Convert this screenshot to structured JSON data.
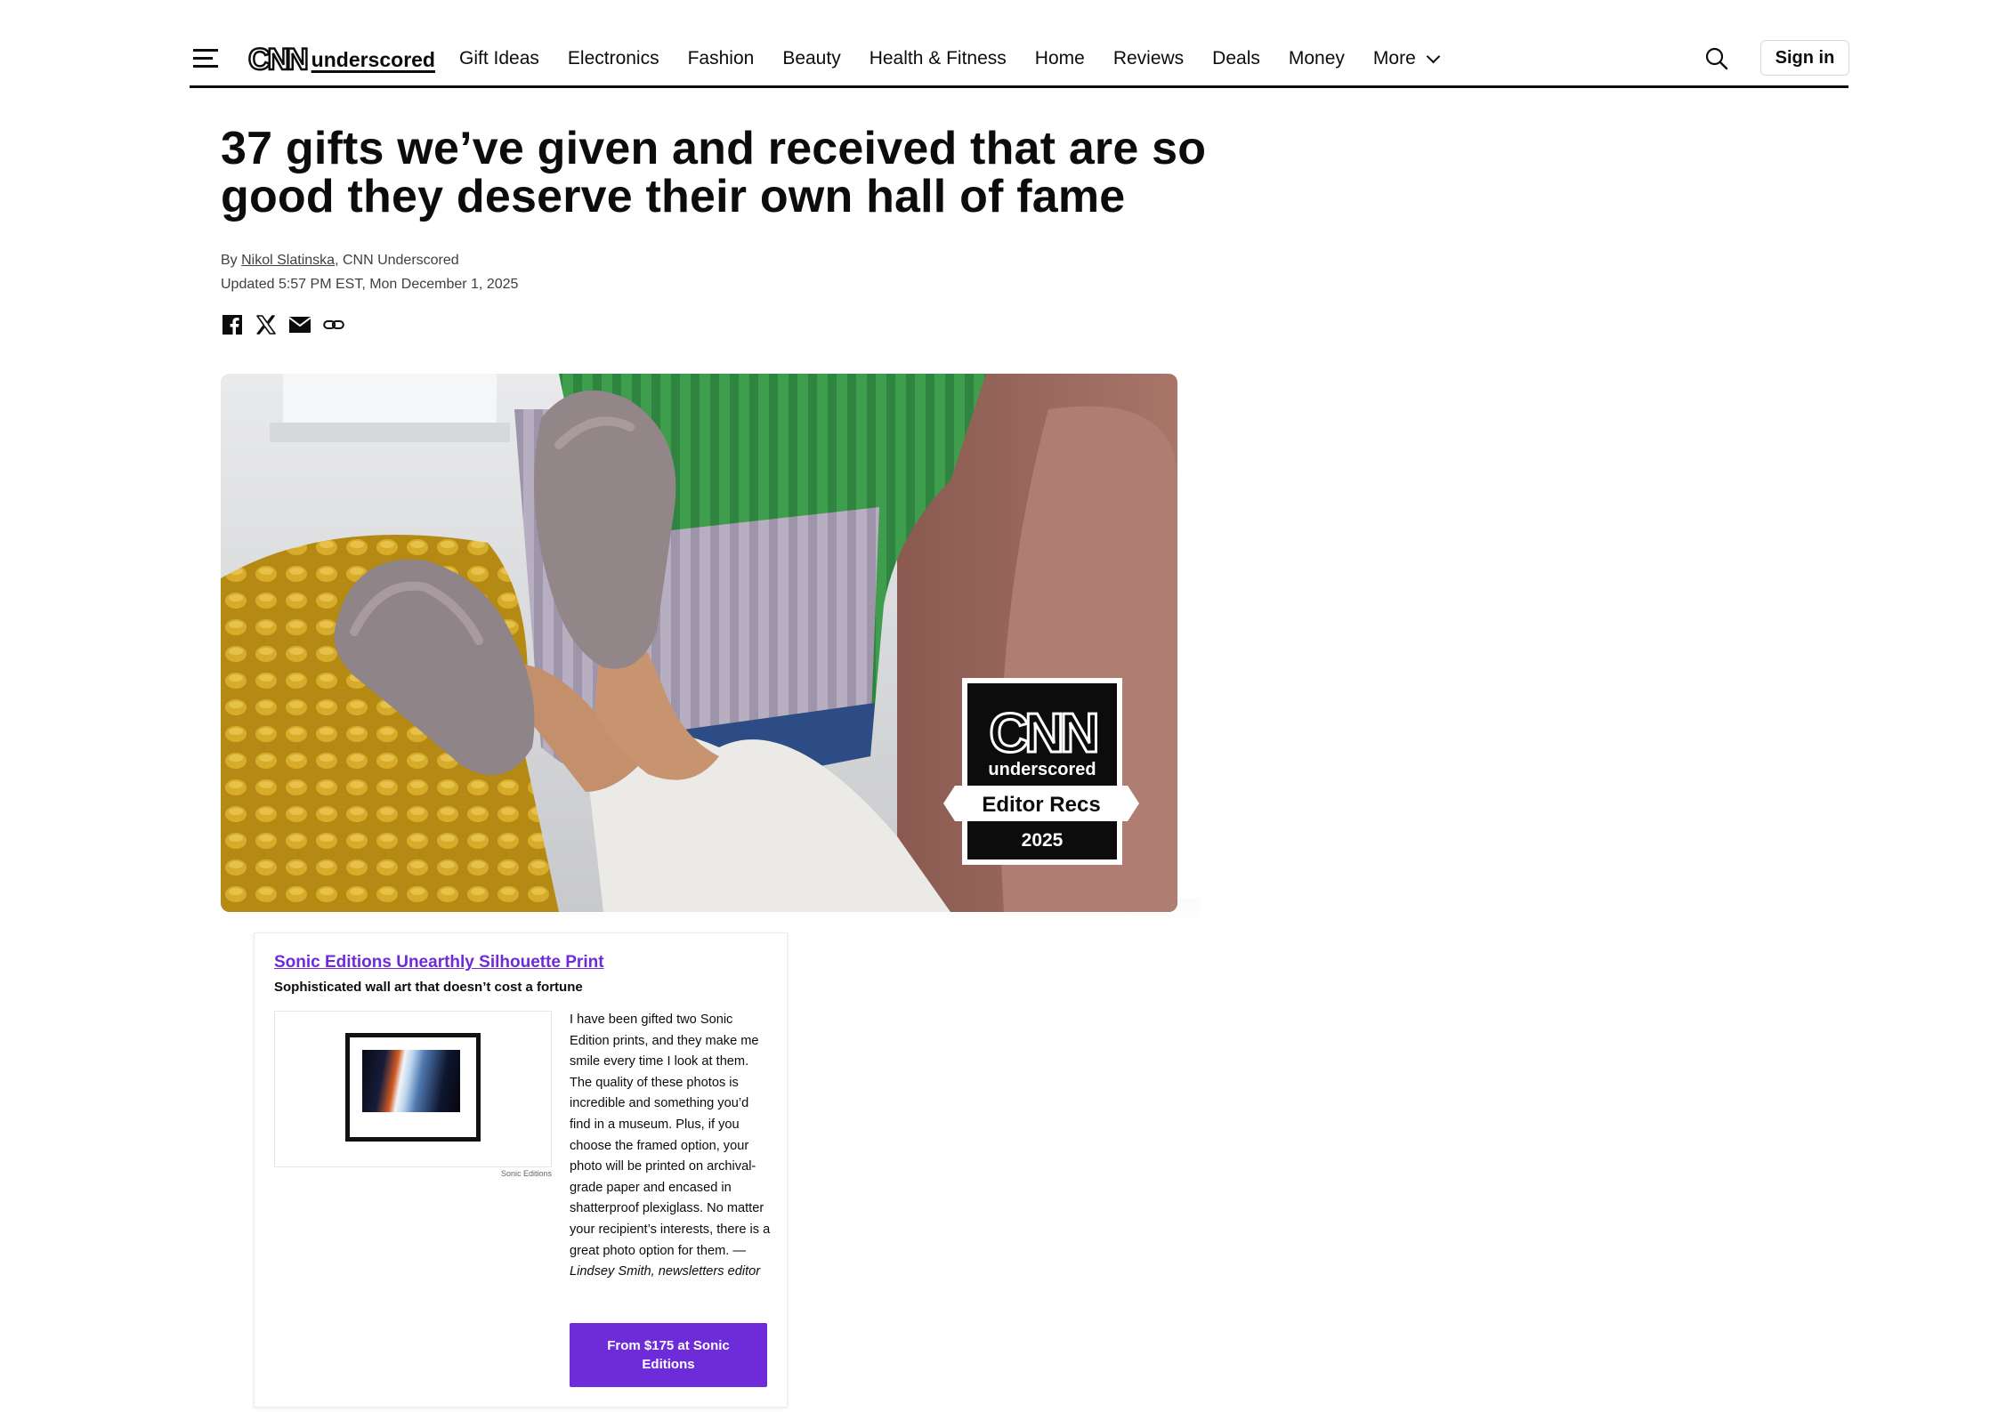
{
  "header": {
    "logo": {
      "mark": "CNN",
      "word": "underscored"
    },
    "nav": [
      "Gift Ideas",
      "Electronics",
      "Fashion",
      "Beauty",
      "Health & Fitness",
      "Home",
      "Reviews",
      "Deals",
      "Money"
    ],
    "more_label": "More",
    "sign_in_label": "Sign in"
  },
  "article": {
    "headline": "37 gifts we’ve given and received that are so good they deserve their own hall of fame",
    "byline_prefix": "By ",
    "author": "Nikol Slatinska",
    "byline_suffix": ", CNN Underscored",
    "updated": "Updated 5:57 PM EST, Mon December 1, 2025",
    "share_icons": [
      "facebook-icon",
      "x-icon",
      "email-icon",
      "link-icon"
    ]
  },
  "hero": {
    "badge": {
      "mark": "CNN",
      "word": "underscored",
      "ribbon": "Editor Recs",
      "year": "2025"
    }
  },
  "product": {
    "title": "Sonic Editions Unearthly Silhouette Print",
    "subtitle": "Sophisticated wall art that doesn’t cost a fortune",
    "image_credit": "Sonic Editions",
    "body": "I have been gifted two Sonic Edition prints, and they make me smile every time I look at them. The quality of these photos is incredible and something you’d find in a museum. Plus, if you choose the framed option, your photo will be printed on archival-grade paper and encased in shatterproof plexiglass. No matter your recipient’s interests, there is a great photo option for them. — ",
    "attribution": "Lindsey Smith, newsletters editor",
    "cta_label": "From $175 at Sonic Editions"
  },
  "colors": {
    "accent": "#6e2bd9",
    "text": "#0c0c0c",
    "muted": "#404040"
  }
}
